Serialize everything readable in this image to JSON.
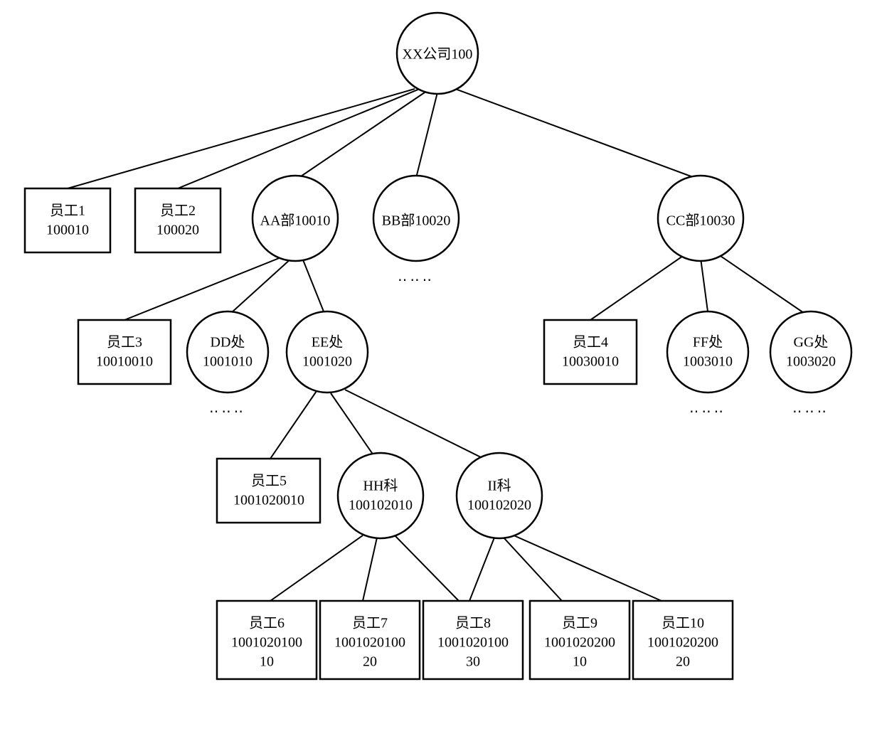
{
  "nodes": {
    "root": {
      "line1": "XX公司100"
    },
    "emp1": {
      "line1": "员工1",
      "line2": "100010"
    },
    "emp2": {
      "line1": "员工2",
      "line2": "100020"
    },
    "aa": {
      "line1": "AA部10010"
    },
    "bb": {
      "line1": "BB部10020"
    },
    "cc": {
      "line1": "CC部10030"
    },
    "emp3": {
      "line1": "员工3",
      "line2": "10010010"
    },
    "dd": {
      "line1": "DD处",
      "line2": "1001010"
    },
    "ee": {
      "line1": "EE处",
      "line2": "1001020"
    },
    "emp4": {
      "line1": "员工4",
      "line2": "10030010"
    },
    "ff": {
      "line1": "FF处",
      "line2": "1003010"
    },
    "gg": {
      "line1": "GG处",
      "line2": "1003020"
    },
    "emp5": {
      "line1": "员工5",
      "line2": "1001020010"
    },
    "hh": {
      "line1": "HH科",
      "line2": "100102010"
    },
    "ii": {
      "line1": "II科",
      "line2": "100102020"
    },
    "emp6": {
      "line1": "员工6",
      "line2": "1001020100",
      "line3": "10"
    },
    "emp7": {
      "line1": "员工7",
      "line2": "1001020100",
      "line3": "20"
    },
    "emp8": {
      "line1": "员工8",
      "line2": "1001020100",
      "line3": "30"
    },
    "emp9": {
      "line1": "员工9",
      "line2": "1001020200",
      "line3": "10"
    },
    "emp10": {
      "line1": "员工10",
      "line2": "1001020200",
      "line3": "20"
    }
  },
  "ellipsis": "‥‥‥"
}
